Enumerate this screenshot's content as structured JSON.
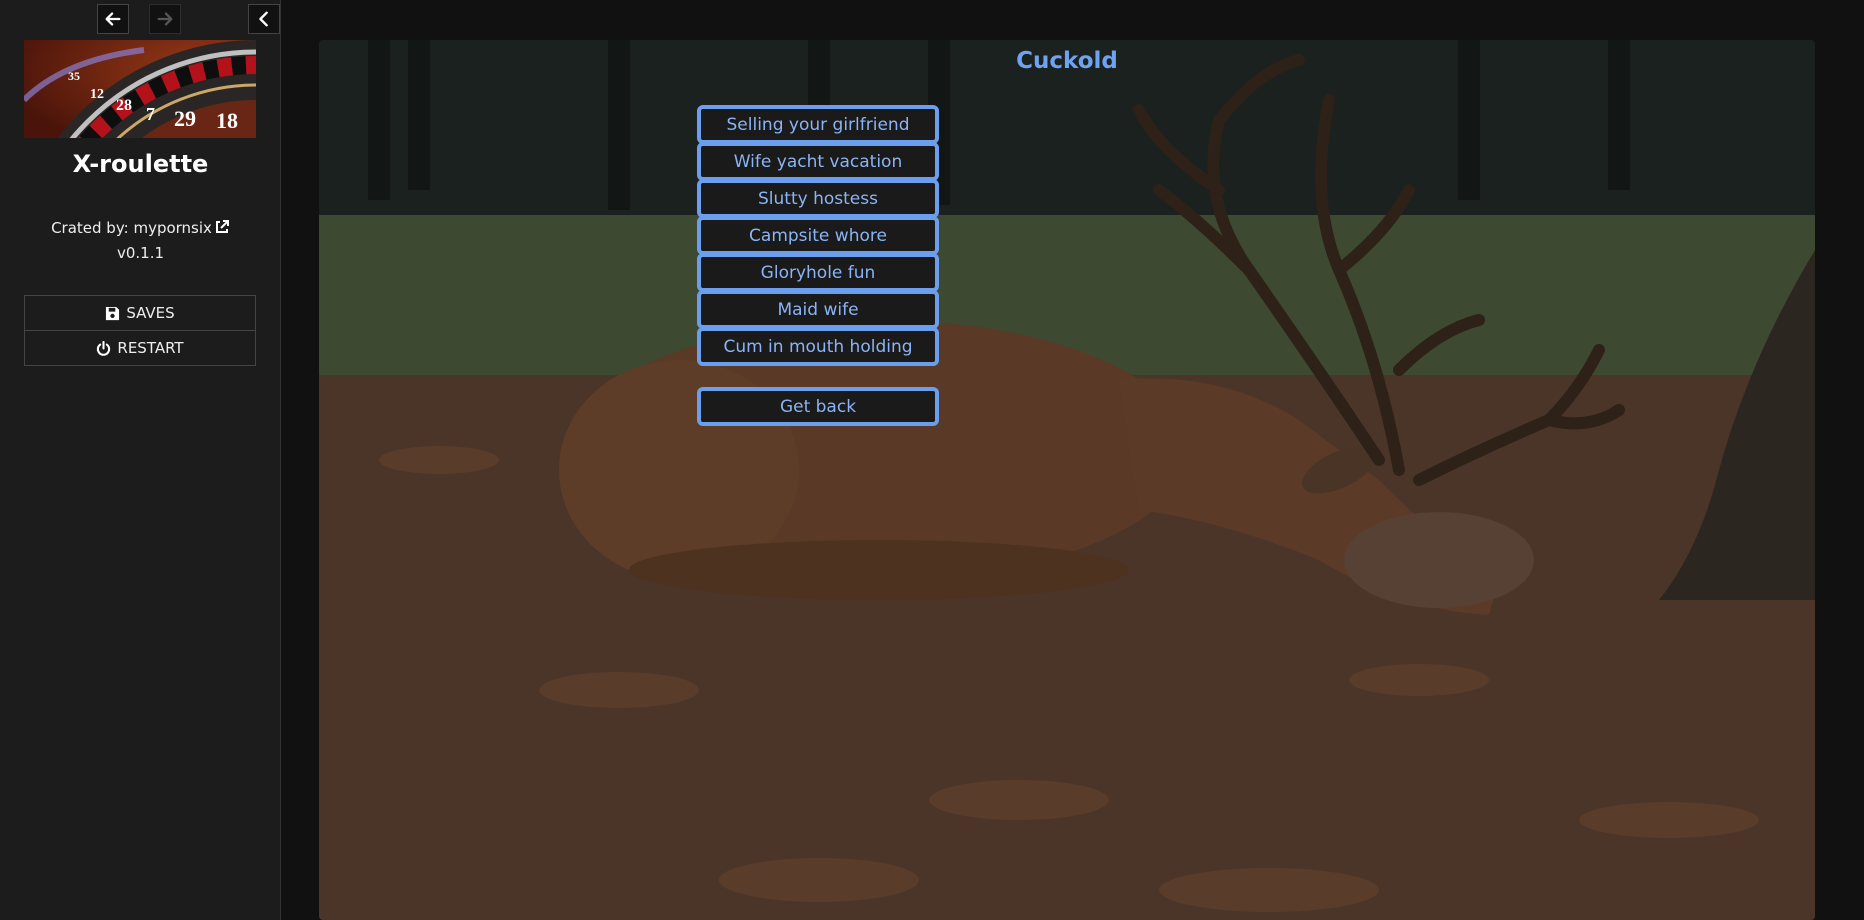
{
  "sidebar": {
    "title": "X-roulette",
    "credit_prefix": "Crated by: ",
    "credit_author": "mypornsix",
    "version": "v0.1.1",
    "saves_label": "SAVES",
    "restart_label": "RESTART",
    "banner_numbers": [
      "29",
      "7",
      "28",
      "12",
      "35",
      "18"
    ]
  },
  "icons": {
    "back": "arrow-left-icon",
    "forward": "arrow-right-icon",
    "collapse": "chevron-left-icon",
    "external": "external-link-icon",
    "saves": "floppy-disk-icon",
    "restart": "power-icon"
  },
  "passage": {
    "title": "Cuckold",
    "choices": [
      "Selling your girlfriend",
      "Wife yacht vacation",
      "Slutty hostess",
      "Campsite whore",
      "Gloryhole fun",
      "Maid wife",
      "Cum in mouth holding"
    ],
    "back_label": "Get back"
  },
  "colors": {
    "accent": "#6fa2ef",
    "choice_border": "#6b9fee",
    "sidebar_bg": "#1c1c1c",
    "page_bg": "#111111"
  }
}
